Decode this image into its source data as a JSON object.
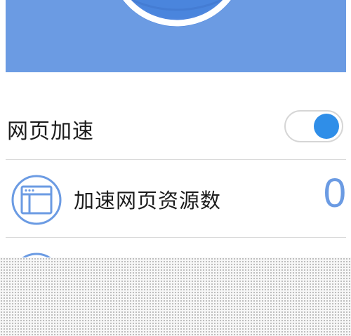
{
  "speedup": {
    "label": "网页加速",
    "enabled": true
  },
  "stats": [
    {
      "label": "加速网页资源数",
      "value": "0",
      "icon": "browser-window-icon"
    },
    {
      "label": "",
      "value": "",
      "icon": "gauge-check-icon"
    }
  ],
  "colors": {
    "hero": "#6b9be3",
    "accent": "#2f8ee8",
    "value": "#6b9be3",
    "divider": "#d9d9d9"
  }
}
